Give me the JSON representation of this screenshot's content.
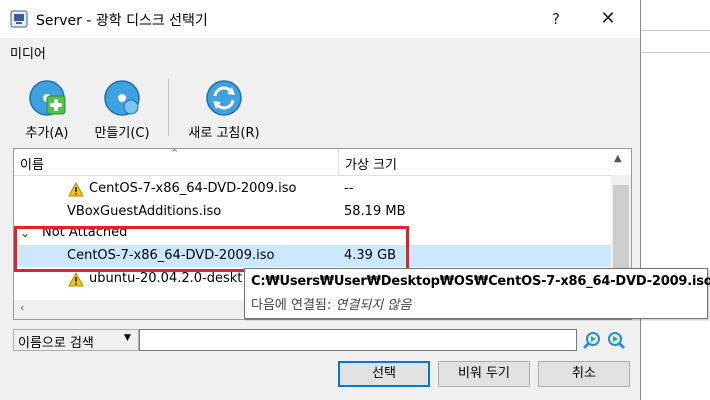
{
  "window": {
    "title": "Server - 광학 디스크 선택기",
    "help": "?",
    "close": "✕"
  },
  "menu": {
    "media": "미디어"
  },
  "toolbar": {
    "add_label": "추가(A)",
    "create_label": "만들기(C)",
    "refresh_label": "새로 고침(R)"
  },
  "tree": {
    "header_name": "이름",
    "header_size": "가상 크기",
    "rows": [
      {
        "name": "CentOS-7-x86_64-DVD-2009.iso",
        "size": "--",
        "warning": true
      },
      {
        "name": "VBoxGuestAdditions.iso",
        "size": "58.19 MB",
        "warning": false
      },
      {
        "name": "Not Attached",
        "size": "",
        "group": true
      },
      {
        "name": "CentOS-7-x86_64-DVD-2009.iso",
        "size": "4.39 GB",
        "selected": true
      },
      {
        "name": "ubuntu-20.04.2.0-deskt",
        "size": "",
        "warning": true
      }
    ]
  },
  "tooltip": {
    "path": "C:₩Users₩User₩Desktop₩OS₩CentOS-7-x86_64-DVD-2009.iso",
    "status_label": "다음에 연결됨:",
    "status_value": "연결되지 않음"
  },
  "search": {
    "mode": "이름으로 검색",
    "value": ""
  },
  "buttons": {
    "select": "선택",
    "hide": "비워 두기",
    "cancel": "취소"
  },
  "colors": {
    "selection": "#cce8ff",
    "highlight": "#e0232a",
    "accent": "#0078d7"
  }
}
